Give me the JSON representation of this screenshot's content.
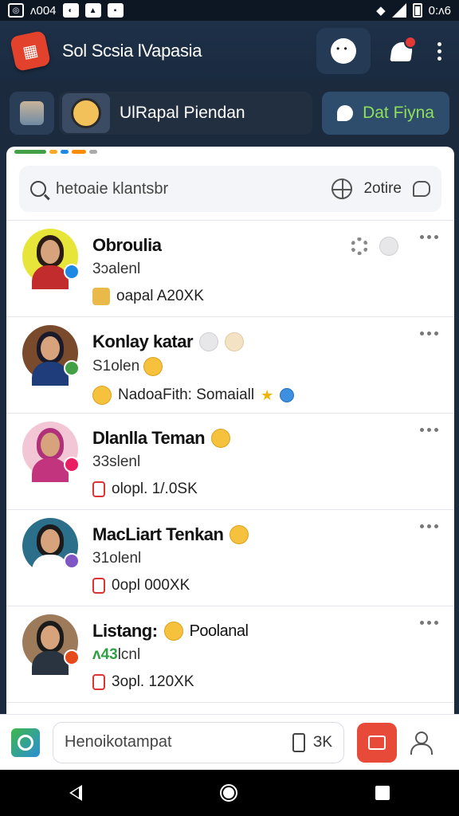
{
  "status_bar": {
    "left_text": "ʌ004",
    "time": "0:ʌ6"
  },
  "app_bar": {
    "title": "Sol Scsia lVapasia",
    "brand_color": "#e2412c"
  },
  "story_bar": {
    "user_name": "UlRapal Piendan",
    "cta_label": "Dat Fiyna",
    "cta_color": "#8ee05a"
  },
  "search": {
    "placeholder": "hetoaie klantsbr",
    "filter_label": "2otire"
  },
  "contacts": [
    {
      "name": "Obroulia",
      "extra": "",
      "sub": "3ɔalenl",
      "sub_prefix": "",
      "meta": "oapal A20XK",
      "avatar_bg": "#e8e53a",
      "badge": "#1e88e5",
      "hair": "#2a1b14",
      "shirt": "#c22c2c"
    },
    {
      "name": "Konlay katar",
      "extra": "",
      "sub": "S1olen",
      "sub_prefix": "",
      "meta": "NadoaFith: Somaiall",
      "avatar_bg": "#7a4a2c",
      "badge": "#43a047",
      "hair": "#1a1a2a",
      "shirt": "#1f3d7a"
    },
    {
      "name": "Dlanlla Teman",
      "extra": "",
      "sub": "33slenl",
      "sub_prefix": "",
      "meta": "olopl. 1/.0SK",
      "avatar_bg": "#f3c6d6",
      "badge": "#e91e63",
      "hair": "#b0307a",
      "shirt": "#c2357e"
    },
    {
      "name": "MacLiart Tenkan",
      "extra": "",
      "sub": "31olenl",
      "sub_prefix": "",
      "meta": "0opl 000XK",
      "avatar_bg": "#2b6f8a",
      "badge": "#7e57c2",
      "hair": "#1b1b1b",
      "shirt": "#ffffff"
    },
    {
      "name": "Listang:",
      "extra": "Poolanal",
      "sub": "lcnl",
      "sub_prefix": "ʌ43",
      "meta": "3opl. 120XK",
      "avatar_bg": "#9c7a5a",
      "badge": "#e64a19",
      "hair": "#1b1b1b",
      "shirt": "#2a3340"
    }
  ],
  "composer": {
    "placeholder": "Henoikotampat",
    "count_label": "ЗK",
    "send_color": "#e84a3a"
  },
  "icons": [
    "app-logo-icon",
    "face-icon",
    "bell-icon",
    "more-icon",
    "search-icon",
    "crosshair-icon",
    "chat-icon",
    "gear-icon",
    "camera-icon",
    "phone-icon",
    "send-icon",
    "profile-icon",
    "back-icon",
    "home-icon",
    "recents-icon"
  ]
}
